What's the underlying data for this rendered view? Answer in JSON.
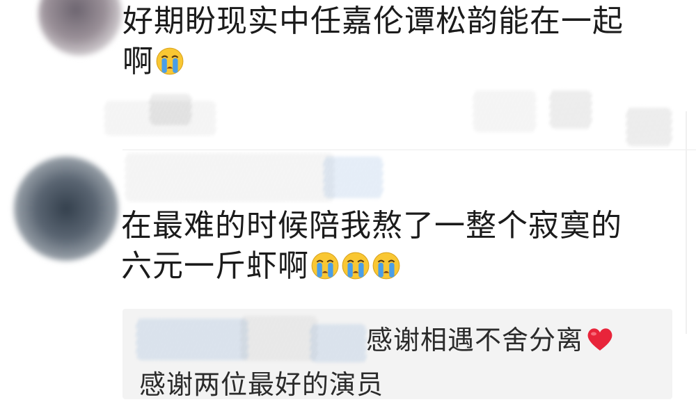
{
  "comments": [
    {
      "lines": [
        "好期盼现实中任嘉伦谭松韵能在一起",
        "啊"
      ],
      "emoji_count": 1,
      "emoji_icon": "crying-face-emoji"
    },
    {
      "lines": [
        "在最难的时候陪我熬了一整个寂寞的",
        "六元一斤虾啊"
      ],
      "emoji_count": 3,
      "emoji_icon": "crying-face-emoji"
    }
  ],
  "reply": {
    "line1": "感谢相遇不舍分离",
    "line1_icon": "red-heart-icon",
    "line2": "感谢两位最好的演员"
  },
  "colors": {
    "text": "#1b1b1b",
    "reply_background": "#f3f3f3",
    "heart": "#e8243a",
    "emoji_face": "#f9c733",
    "emoji_tears": "#4a9ee8"
  }
}
